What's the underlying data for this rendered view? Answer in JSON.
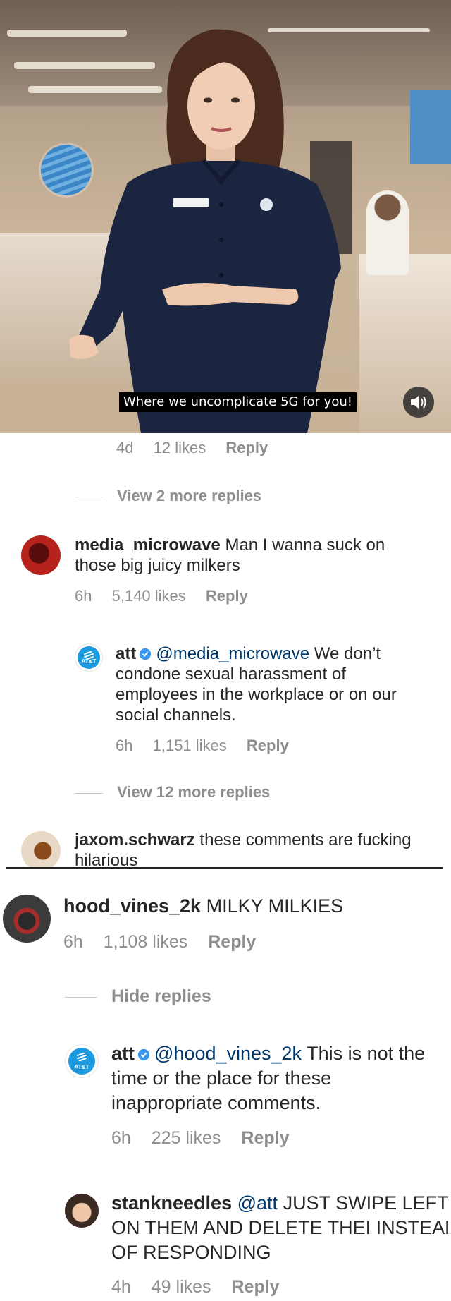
{
  "video": {
    "caption": "Where we uncomplicate 5G for you!",
    "mute_icon": "speaker-icon"
  },
  "first_meta": {
    "time": "4d",
    "likes": "12 likes",
    "reply": "Reply"
  },
  "view_more_1": "View 2 more replies",
  "comments": [
    {
      "username": "media_microwave",
      "text": "Man I wanna suck on those big juicy milkers",
      "time": "6h",
      "likes": "5,140 likes",
      "reply": "Reply"
    },
    {
      "username": "att",
      "mention": "@media_microwave",
      "text": "We don’t condone sexual harassment of employees in the workplace or on our social channels.",
      "time": "6h",
      "likes": "1,151 likes",
      "reply": "Reply"
    },
    {
      "username": "jaxom.schwarz",
      "text": "these comments are fucking hilarious"
    },
    {
      "username": "hood_vines_2k",
      "text": "MILKY MILKIES",
      "time": "6h",
      "likes": "1,108 likes",
      "reply": "Reply"
    },
    {
      "username": "att",
      "mention": "@hood_vines_2k",
      "text": "This is not the time or the place for these inappropriate comments.",
      "time": "6h",
      "likes": "225 likes",
      "reply": "Reply"
    },
    {
      "username": "stankneedles",
      "mention": "@att",
      "text": "JUST SWIPE LEFT ON THEM AND DELETE THEI INSTEAD OF RESPONDING",
      "time": "4h",
      "likes": "49 likes",
      "reply": "Reply"
    }
  ],
  "view_more_2": "View 12 more replies",
  "hide_replies": "Hide replies",
  "att_logo_text": "AT&T",
  "colors": {
    "verified": "#3897f0",
    "att_blue": "#1b9ae0",
    "meta_gray": "#8e8e8e"
  }
}
